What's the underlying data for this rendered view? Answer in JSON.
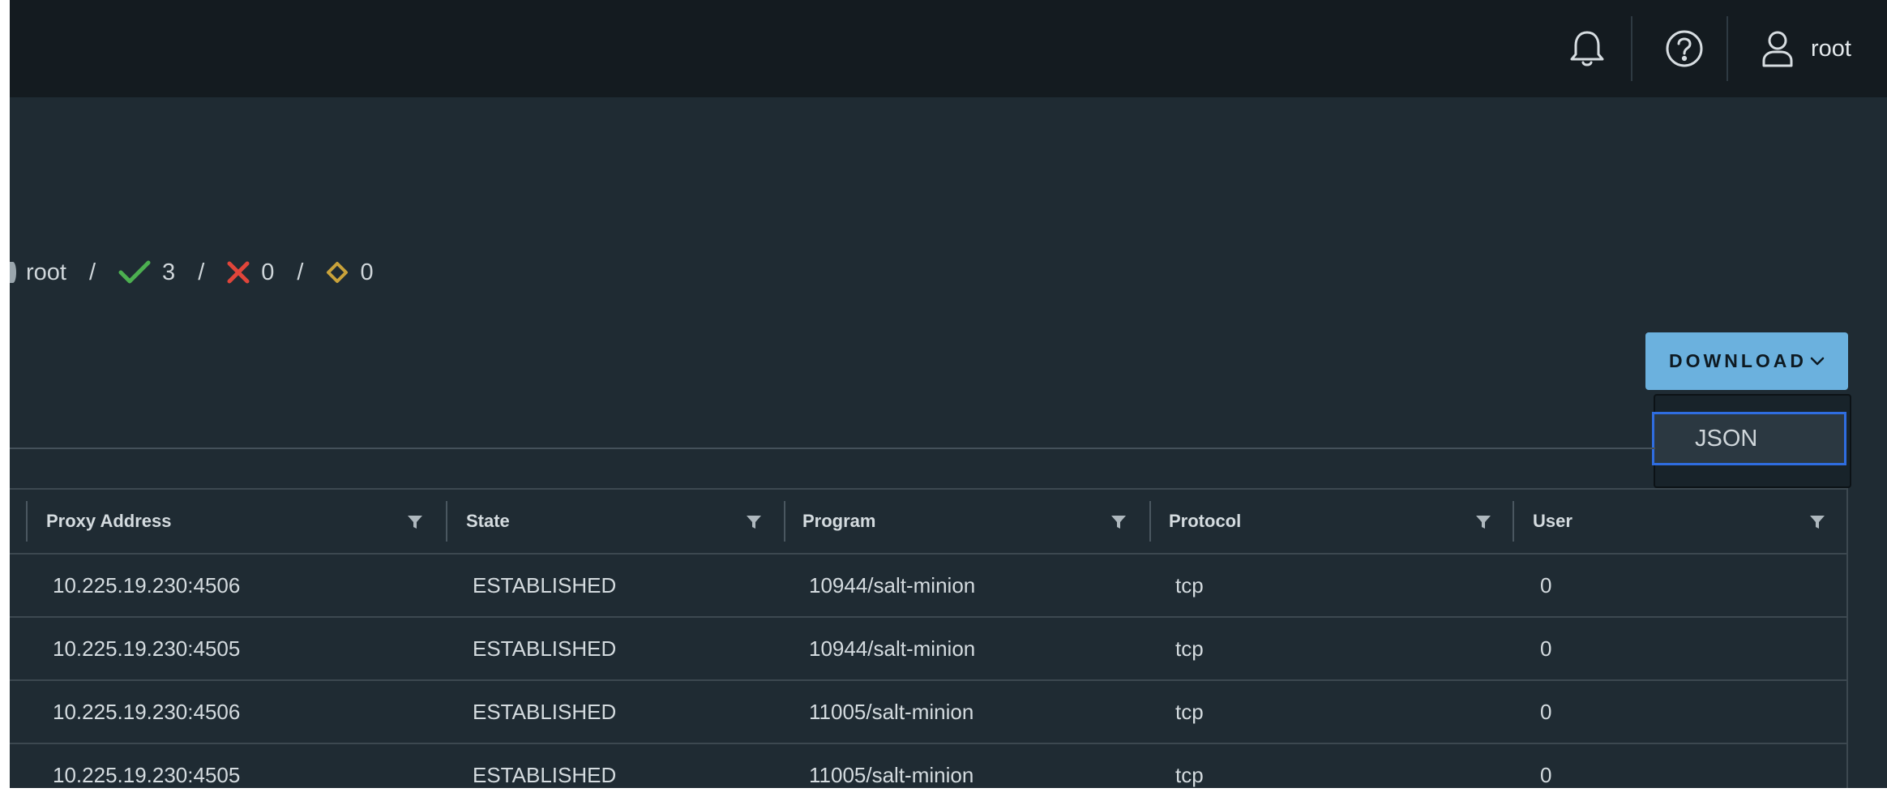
{
  "header": {
    "user_name": "root",
    "icons": [
      "bell-icon",
      "help-icon",
      "user-icon"
    ]
  },
  "status": {
    "user": "root",
    "success_count": "3",
    "failure_count": "0",
    "warning_count": "0",
    "separator": "/",
    "colors": {
      "success": "#4caf50",
      "failure": "#e0453a",
      "warning": "#c9a23a"
    }
  },
  "download": {
    "label": "DOWNLOAD",
    "menu_items": [
      {
        "label": "JSON"
      }
    ]
  },
  "table": {
    "columns": [
      {
        "label": "Proxy Address"
      },
      {
        "label": "State"
      },
      {
        "label": "Program"
      },
      {
        "label": "Protocol"
      },
      {
        "label": "User"
      }
    ],
    "rows": [
      {
        "proxy": "10.225.19.230:4506",
        "state": "ESTABLISHED",
        "program": "10944/salt-minion",
        "protocol": "tcp",
        "user": "0"
      },
      {
        "proxy": "10.225.19.230:4505",
        "state": "ESTABLISHED",
        "program": "10944/salt-minion",
        "protocol": "tcp",
        "user": "0"
      },
      {
        "proxy": "10.225.19.230:4506",
        "state": "ESTABLISHED",
        "program": "11005/salt-minion",
        "protocol": "tcp",
        "user": "0"
      },
      {
        "proxy": "10.225.19.230:4505",
        "state": "ESTABLISHED",
        "program": "11005/salt-minion",
        "protocol": "tcp",
        "user": "0"
      }
    ]
  }
}
